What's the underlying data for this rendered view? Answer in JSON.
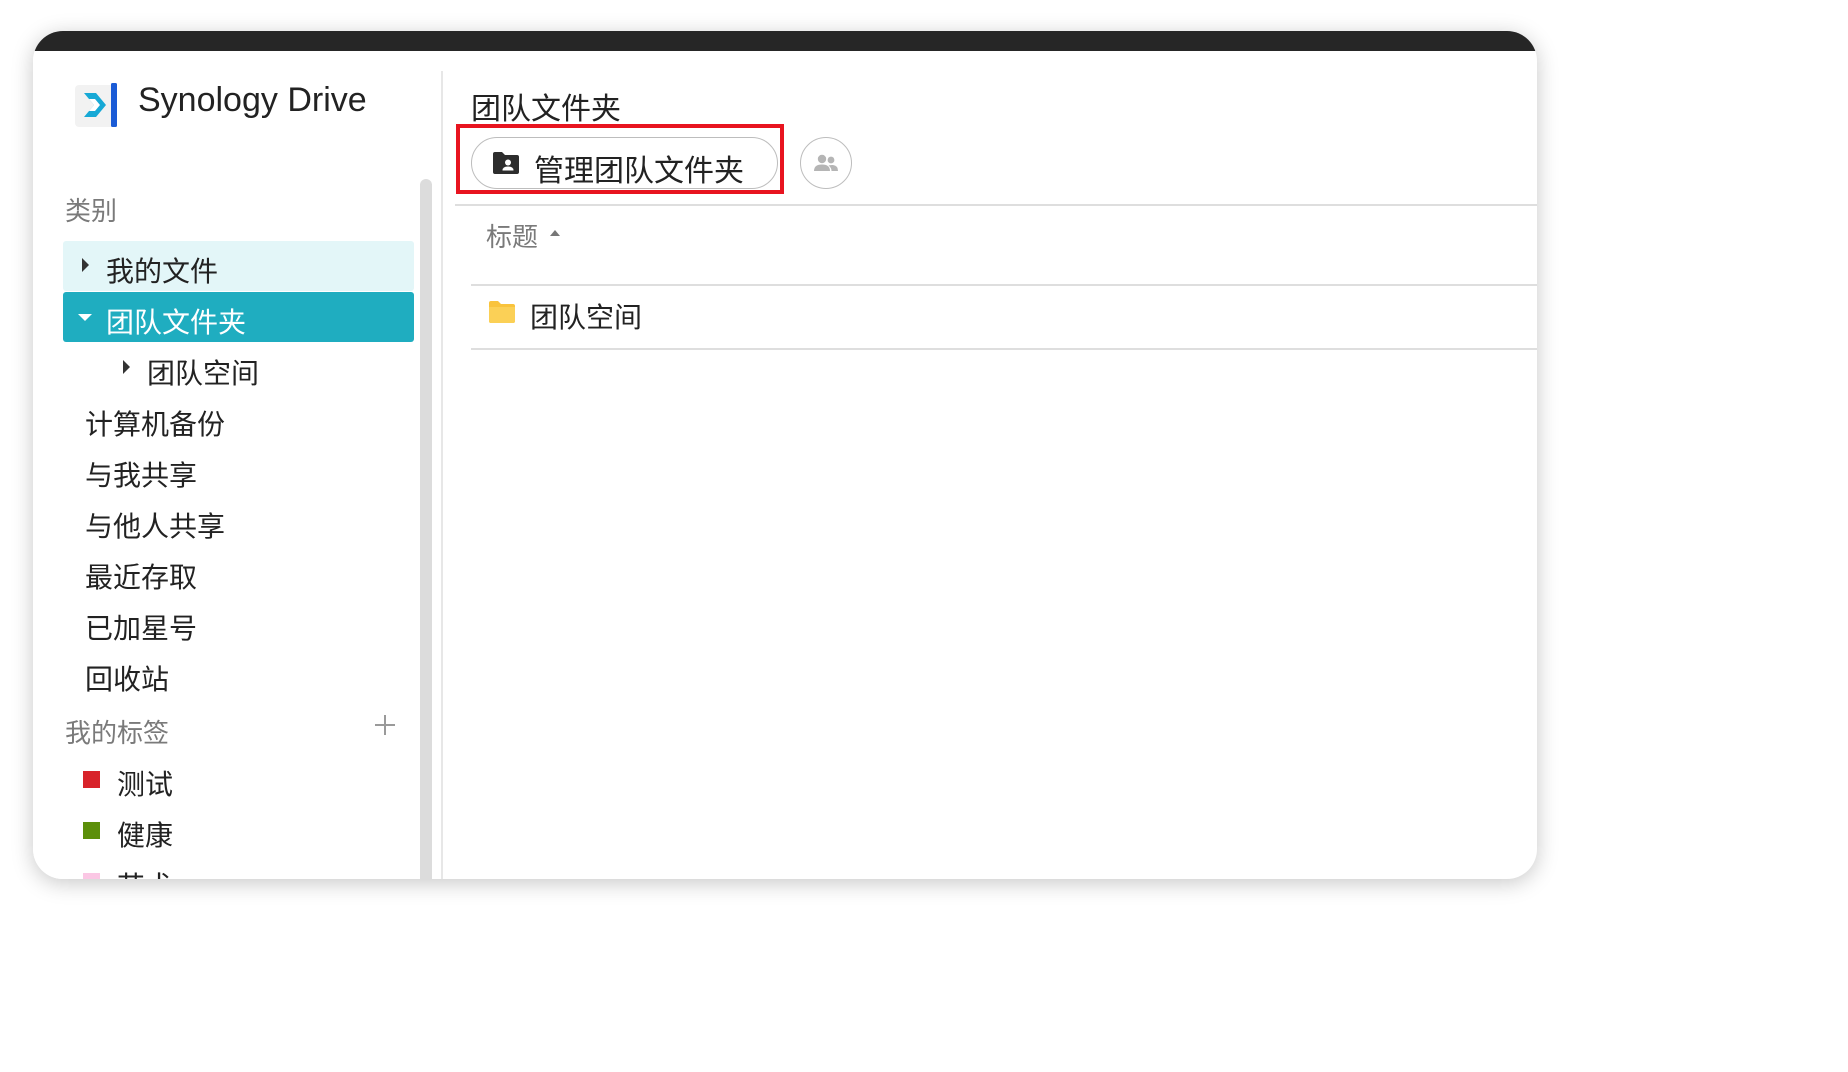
{
  "app": {
    "name": "Synology Drive",
    "logo_icon": "synology-drive-logo"
  },
  "sidebar": {
    "category_title": "类别",
    "items": [
      {
        "label": "我的文件",
        "expanded": false
      },
      {
        "label": "团队文件夹",
        "expanded": true,
        "active": true
      },
      {
        "label": "团队空间",
        "child": true
      },
      {
        "label": "计算机备份"
      },
      {
        "label": "与我共享"
      },
      {
        "label": "与他人共享"
      },
      {
        "label": "最近存取"
      },
      {
        "label": "已加星号"
      },
      {
        "label": "回收站"
      }
    ],
    "tags_title": "我的标签",
    "tags": [
      {
        "label": "测试",
        "color": "#d8232a"
      },
      {
        "label": "健康",
        "color": "#5c8f0a"
      },
      {
        "label": "艺术",
        "color": "#fbc7e4"
      }
    ]
  },
  "main": {
    "title": "团队文件夹",
    "manage_button_label": "管理团队文件夹",
    "manage_button_icon": "folder-person-icon",
    "members_button_icon": "users-icon",
    "column_header": "标题",
    "rows": [
      {
        "name": "团队空间",
        "icon": "folder-icon"
      }
    ]
  },
  "colors": {
    "accent": "#1fadc0",
    "hover": "#e3f6f8",
    "highlight_border": "#e8141f",
    "folder": "#f9c33c"
  }
}
